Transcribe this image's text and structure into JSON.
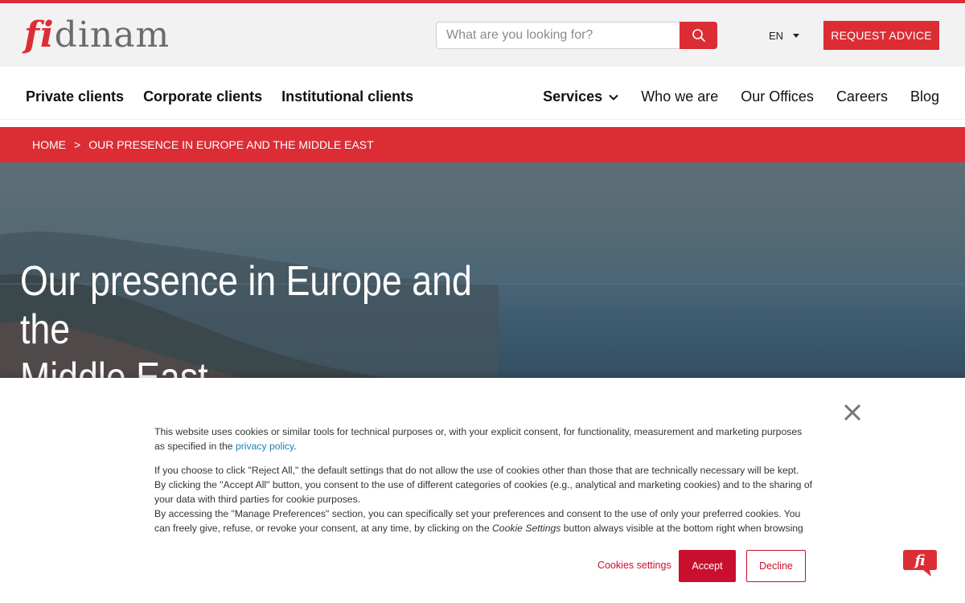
{
  "brand": {
    "logo_f": "fi",
    "logo_rest": "dinam",
    "accent": "#dc2d35"
  },
  "header": {
    "search": {
      "placeholder": "What are you looking for?",
      "icon": "search-icon"
    },
    "language": "EN",
    "request_advice": "REQUEST ADVICE"
  },
  "nav": {
    "left": [
      "Private clients",
      "Corporate clients",
      "Institutional clients"
    ],
    "services": "Services",
    "right": [
      "Who we are",
      "Our Offices",
      "Careers",
      "Blog"
    ]
  },
  "breadcrumb": {
    "home": "HOME",
    "separator": ">",
    "current": "OUR PRESENCE IN EUROPE AND THE MIDDLE EAST"
  },
  "hero": {
    "title_line1": "Our presence in Europe and the",
    "title_line2": "Middle East"
  },
  "cookie": {
    "p1_a": "This website uses cookies or similar tools for technical purposes or, with your explicit consent, for functionality, measurement and marketing purposes as specified in the ",
    "p1_link": "privacy policy",
    "p1_b": ".",
    "p2_l1": "If you choose to click \"Reject All,\" the default settings that do not allow the use of cookies other than those that are technically necessary will be kept.",
    "p2_l2": "By clicking the \"Accept All\" button, you consent to the use of different categories of cookies (e.g., analytical and marketing cookies) and to the sharing of your data with third parties for cookie purposes.",
    "p2_l3a": "By accessing the \"Manage Preferences\" section, you can specifically set your preferences and consent to the use of only your preferred cookies. You can freely give, refuse, or revoke your consent, at any time, by clicking on the ",
    "p2_l3em": "Cookie Settings",
    "p2_l3b": " button always visible at the bottom right when browsing",
    "settings": "Cookies settings",
    "accept": "Accept",
    "decline": "Decline"
  },
  "chat_badge": {
    "label": "fi"
  }
}
